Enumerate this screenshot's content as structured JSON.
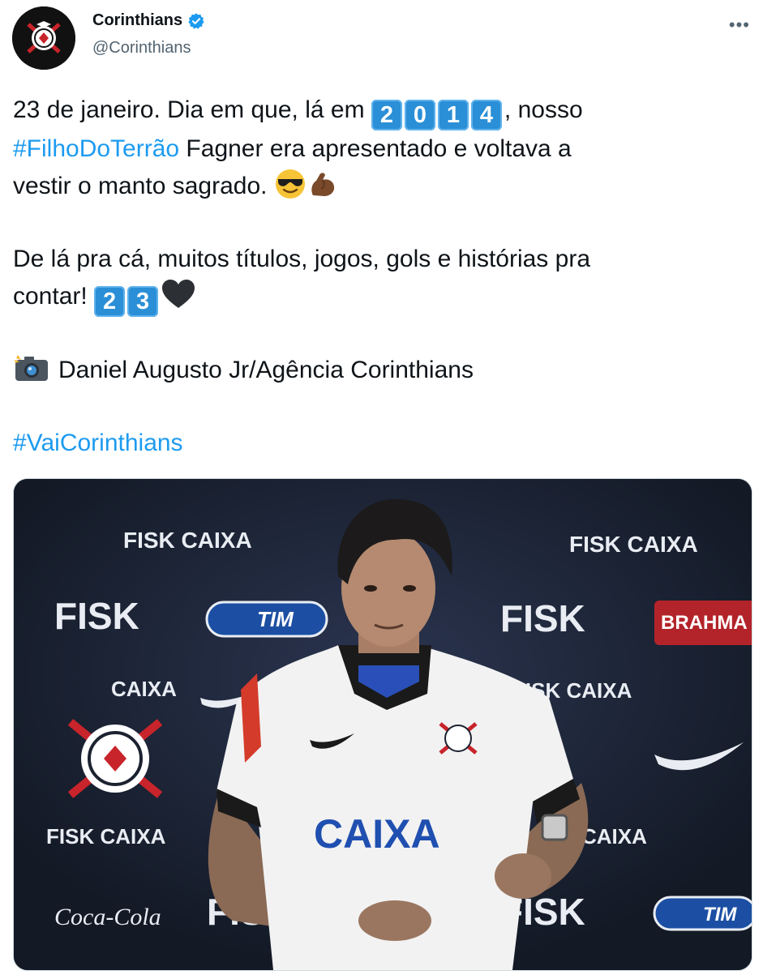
{
  "tweet": {
    "author_name": "Corinthians",
    "author_handle": "@Corinthians",
    "verified_icon": "verified-badge-icon",
    "more_label": "•••",
    "line1_a": "23 de janeiro. Dia em que, lá em ",
    "year_digits": [
      "2",
      "0",
      "1",
      "4"
    ],
    "line1_b": ", nosso",
    "hashtag_filho": "#FilhoDoTerrão",
    "line2_b": " Fagner era apresentado e voltava a",
    "line3": "vestir o manto sagrado. ",
    "emojis_line3": [
      "smiling-face-with-sunglasses-icon",
      "flexed-biceps-icon"
    ],
    "para2_line1": "De lá pra cá, muitos títulos, jogos, gols e histórias pra",
    "para2_line2": "contar! ",
    "number_digits": [
      "2",
      "3"
    ],
    "heart_icon": "black-heart-icon",
    "camera_icon": "camera-with-flash-icon",
    "credit": "Daniel Augusto Jr/Agência Corinthians",
    "hashtag_vai": "#VaiCorinthians"
  },
  "media": {
    "backdrop_fisk": "FISK",
    "backdrop_caixa": "CAIXA",
    "backdrop_tim": "TIM",
    "backdrop_brahma": "BRAHMA",
    "backdrop_fisk_caixa": "FISK CAIXA",
    "jersey_sponsor": "CAIXA",
    "coca_cola": "Coca-Cola"
  },
  "colors": {
    "link": "#1d9bf0",
    "keycap": "#2a8fd6",
    "text": "#0f1419",
    "secondary": "#536471"
  }
}
